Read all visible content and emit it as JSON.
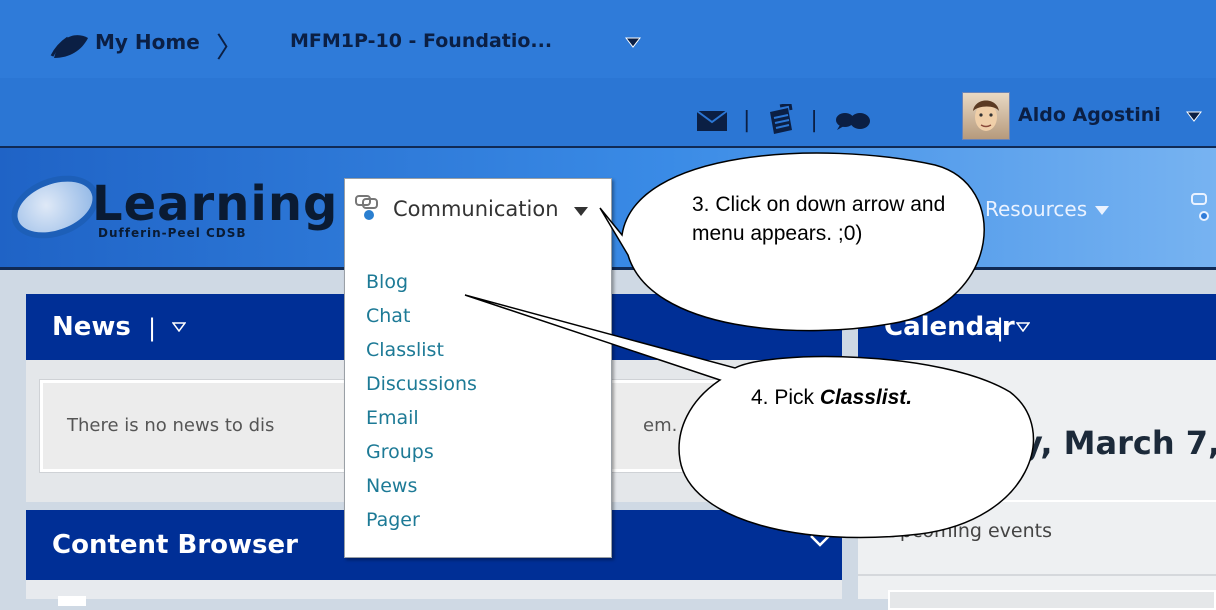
{
  "breadcrumb": {
    "home": "My Home",
    "course": "MFM1P-10 - Foundatio..."
  },
  "header": {
    "user_name": "Aldo Agostini",
    "icons": [
      "mail-icon",
      "notes-icon",
      "chat-icon"
    ]
  },
  "brand": {
    "name": "Learning",
    "subtitle": "Dufferin-Peel CDSB"
  },
  "nav": {
    "communication_label": "Communication",
    "resources_label": "Resources"
  },
  "menu": {
    "items": [
      "Blog",
      "Chat",
      "Classlist",
      "Discussions",
      "Email",
      "Groups",
      "News",
      "Pager"
    ]
  },
  "news": {
    "title": "News",
    "message_left": "There is no news to dis",
    "message_right": "em."
  },
  "content_browser": {
    "title": "Content Browser"
  },
  "calendar": {
    "title": "Calendar",
    "date_text": "y, March 7,",
    "upcoming_label": "Upcoming events"
  },
  "callouts": {
    "step3": "3. Click on down arrow and menu appears.  ;0)",
    "step4_prefix": "4. Pick ",
    "step4_emphasis": "Classlist."
  },
  "colors": {
    "header_blue": "#2f7bd9",
    "panel_header": "#002f96",
    "menu_link": "#1d7a96"
  }
}
